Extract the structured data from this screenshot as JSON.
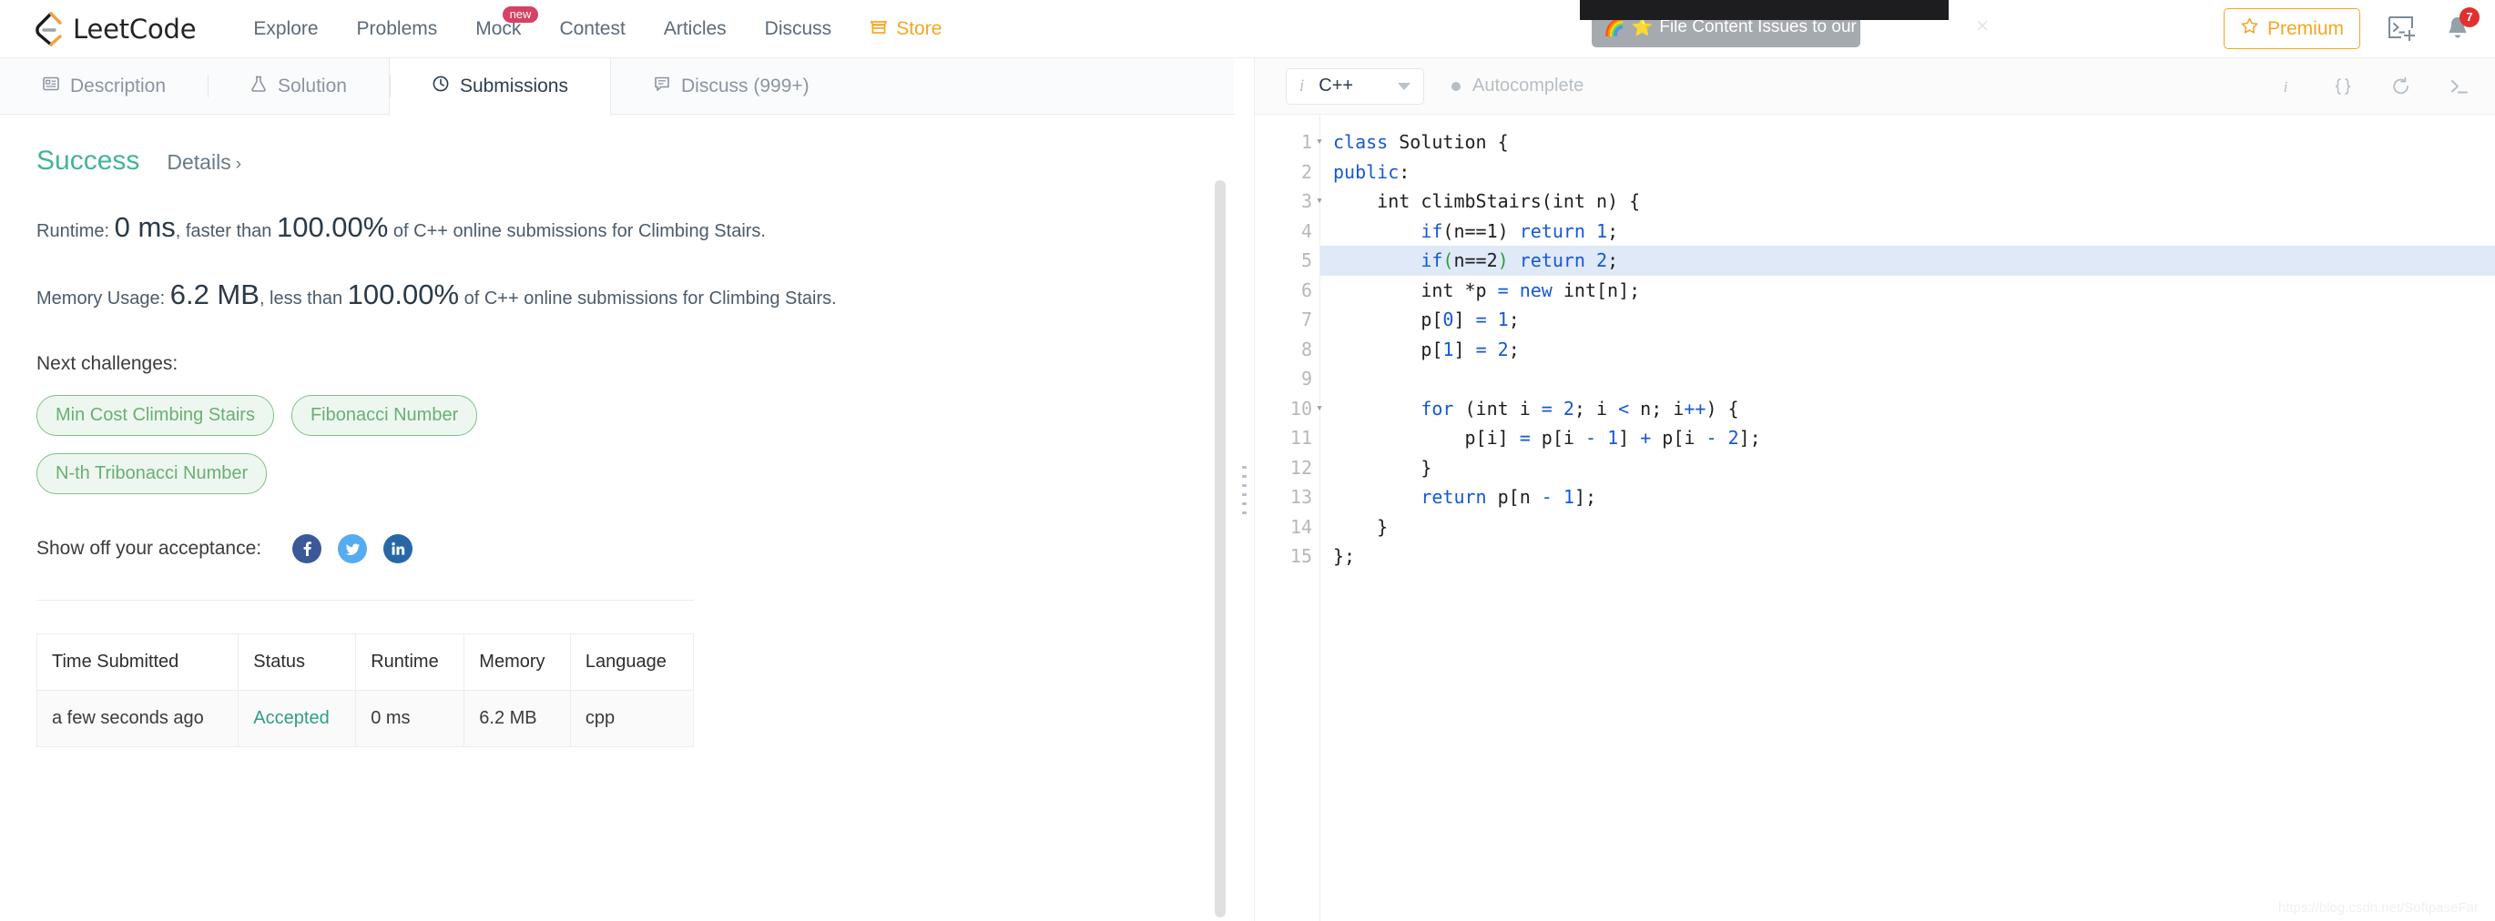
{
  "navbar": {
    "logo_text": "LeetCode",
    "logo_icon": "leetcode-logo-icon",
    "links": [
      {
        "label": "Explore",
        "badge": null
      },
      {
        "label": "Problems",
        "badge": null
      },
      {
        "label": "Mock",
        "badge": "new"
      },
      {
        "label": "Contest",
        "badge": null
      },
      {
        "label": "Articles",
        "badge": null
      },
      {
        "label": "Discuss",
        "badge": null
      }
    ],
    "store": {
      "label": "Store",
      "icon": "store-icon",
      "color": "#f5a623"
    },
    "premium": {
      "label": "Premium",
      "icon": "star-outline-icon",
      "color": "#f5a623"
    },
    "terminal_icon": "terminal-plus-icon",
    "bell": {
      "icon": "bell-icon",
      "count": "7",
      "badge_color": "#e03131"
    }
  },
  "toast": {
    "rainbow": "🌈",
    "star": "⭐",
    "message": "File Content Issues to our Github Repo!",
    "close": "✕"
  },
  "tabs": [
    {
      "label": "Description",
      "icon": "description-icon",
      "active": false
    },
    {
      "label": "Solution",
      "icon": "flask-icon",
      "active": false
    },
    {
      "label": "Submissions",
      "icon": "clock-icon",
      "active": true
    },
    {
      "label": "Discuss (999+)",
      "icon": "comment-icon",
      "active": false
    }
  ],
  "result": {
    "status": "Success",
    "status_color": "#45b39b",
    "details_link": "Details",
    "details_chevron": "›",
    "runtime": {
      "prefix": "Runtime:",
      "value": "0 ms",
      "middle": ", faster than",
      "percent": "100.00%",
      "suffix": "of C++ online submissions for Climbing Stairs."
    },
    "memory": {
      "prefix": "Memory Usage:",
      "value": "6.2 MB",
      "middle": ", less than",
      "percent": "100.00%",
      "suffix": "of C++ online submissions for Climbing Stairs."
    }
  },
  "next_challenges": {
    "title": "Next challenges:",
    "chips": [
      "Min Cost Climbing Stairs",
      "Fibonacci Number",
      "N-th Tribonacci Number"
    ]
  },
  "share": {
    "label": "Show off your acceptance:",
    "buttons": [
      {
        "name": "facebook-icon",
        "color": "#3b5998"
      },
      {
        "name": "twitter-icon",
        "color": "#55acee"
      },
      {
        "name": "linkedin-icon",
        "color": "#2867a6"
      }
    ]
  },
  "submissions_table": {
    "headers": [
      "Time Submitted",
      "Status",
      "Runtime",
      "Memory",
      "Language"
    ],
    "rows": [
      {
        "time": "a few seconds ago",
        "status": "Accepted",
        "runtime": "0 ms",
        "memory": "6.2 MB",
        "language": "cpp"
      }
    ]
  },
  "editor": {
    "language_selected": "C++",
    "language_info_icon": "info-italic-icon",
    "caret_icon": "chevron-down-icon",
    "autocomplete_label": "Autocomplete",
    "tools": [
      {
        "name": "info-icon",
        "glyph": "i"
      },
      {
        "name": "format-braces-icon",
        "glyph": "{}"
      },
      {
        "name": "reset-icon",
        "glyph": "↺"
      },
      {
        "name": "console-icon",
        "glyph": ">_"
      }
    ],
    "highlighted_line": 5,
    "fold_lines": [
      1,
      3,
      10
    ],
    "lines": [
      {
        "n": 1,
        "tokens": [
          {
            "t": "class ",
            "c": "kw"
          },
          {
            "t": "Solution",
            "c": "plain"
          },
          {
            "t": " {",
            "c": "plain"
          }
        ]
      },
      {
        "n": 2,
        "tokens": [
          {
            "t": "public",
            "c": "kw"
          },
          {
            "t": ":",
            "c": "plain"
          }
        ]
      },
      {
        "n": 3,
        "tokens": [
          {
            "t": "    int ",
            "c": "plain"
          },
          {
            "t": "climbStairs(int n) {",
            "c": "plain"
          }
        ]
      },
      {
        "n": 4,
        "tokens": [
          {
            "t": "        ",
            "c": "plain"
          },
          {
            "t": "if",
            "c": "kw"
          },
          {
            "t": "(",
            "c": "plain"
          },
          {
            "t": "n==1",
            "c": "plain"
          },
          {
            "t": ")",
            "c": "plain"
          },
          {
            "t": " return ",
            "c": "kw"
          },
          {
            "t": "1",
            "c": "num"
          },
          {
            "t": ";",
            "c": "plain"
          }
        ]
      },
      {
        "n": 5,
        "tokens": [
          {
            "t": "        ",
            "c": "plain"
          },
          {
            "t": "if",
            "c": "kw"
          },
          {
            "t": "(",
            "c": "grn"
          },
          {
            "t": "n==2",
            "c": "plain"
          },
          {
            "t": ")",
            "c": "grn"
          },
          {
            "t": " return ",
            "c": "kw"
          },
          {
            "t": "2",
            "c": "num"
          },
          {
            "t": ";",
            "c": "plain"
          }
        ]
      },
      {
        "n": 6,
        "tokens": [
          {
            "t": "        int *p ",
            "c": "plain"
          },
          {
            "t": "=",
            "c": "kw"
          },
          {
            "t": " ",
            "c": "plain"
          },
          {
            "t": "new",
            "c": "kw"
          },
          {
            "t": " int[n];",
            "c": "plain"
          }
        ]
      },
      {
        "n": 7,
        "tokens": [
          {
            "t": "        p[",
            "c": "plain"
          },
          {
            "t": "0",
            "c": "num"
          },
          {
            "t": "] ",
            "c": "plain"
          },
          {
            "t": "=",
            "c": "kw"
          },
          {
            "t": " ",
            "c": "plain"
          },
          {
            "t": "1",
            "c": "num"
          },
          {
            "t": ";",
            "c": "plain"
          }
        ]
      },
      {
        "n": 8,
        "tokens": [
          {
            "t": "        p[",
            "c": "plain"
          },
          {
            "t": "1",
            "c": "num"
          },
          {
            "t": "] ",
            "c": "plain"
          },
          {
            "t": "=",
            "c": "kw"
          },
          {
            "t": " ",
            "c": "plain"
          },
          {
            "t": "2",
            "c": "num"
          },
          {
            "t": ";",
            "c": "plain"
          }
        ]
      },
      {
        "n": 9,
        "tokens": [
          {
            "t": "",
            "c": "plain"
          }
        ]
      },
      {
        "n": 10,
        "tokens": [
          {
            "t": "        ",
            "c": "plain"
          },
          {
            "t": "for",
            "c": "kw"
          },
          {
            "t": " (int i ",
            "c": "plain"
          },
          {
            "t": "=",
            "c": "kw"
          },
          {
            "t": " ",
            "c": "plain"
          },
          {
            "t": "2",
            "c": "num"
          },
          {
            "t": "; i ",
            "c": "plain"
          },
          {
            "t": "<",
            "c": "kw"
          },
          {
            "t": " n; i",
            "c": "plain"
          },
          {
            "t": "++",
            "c": "kw"
          },
          {
            "t": ") {",
            "c": "plain"
          }
        ]
      },
      {
        "n": 11,
        "tokens": [
          {
            "t": "            p[i] ",
            "c": "plain"
          },
          {
            "t": "=",
            "c": "kw"
          },
          {
            "t": " p[i ",
            "c": "plain"
          },
          {
            "t": "-",
            "c": "kw"
          },
          {
            "t": " ",
            "c": "plain"
          },
          {
            "t": "1",
            "c": "num"
          },
          {
            "t": "] ",
            "c": "plain"
          },
          {
            "t": "+",
            "c": "kw"
          },
          {
            "t": " p[i ",
            "c": "plain"
          },
          {
            "t": "-",
            "c": "kw"
          },
          {
            "t": " ",
            "c": "plain"
          },
          {
            "t": "2",
            "c": "num"
          },
          {
            "t": "];",
            "c": "plain"
          }
        ]
      },
      {
        "n": 12,
        "tokens": [
          {
            "t": "        }",
            "c": "plain"
          }
        ]
      },
      {
        "n": 13,
        "tokens": [
          {
            "t": "        ",
            "c": "plain"
          },
          {
            "t": "return",
            "c": "kw"
          },
          {
            "t": " p[n ",
            "c": "plain"
          },
          {
            "t": "-",
            "c": "kw"
          },
          {
            "t": " ",
            "c": "plain"
          },
          {
            "t": "1",
            "c": "num"
          },
          {
            "t": "];",
            "c": "plain"
          }
        ]
      },
      {
        "n": 14,
        "tokens": [
          {
            "t": "    }",
            "c": "plain"
          }
        ]
      },
      {
        "n": 15,
        "tokens": [
          {
            "t": "};",
            "c": "plain"
          }
        ]
      }
    ]
  },
  "watermark": "https://blog.csdn.net/SoftpaseFar"
}
